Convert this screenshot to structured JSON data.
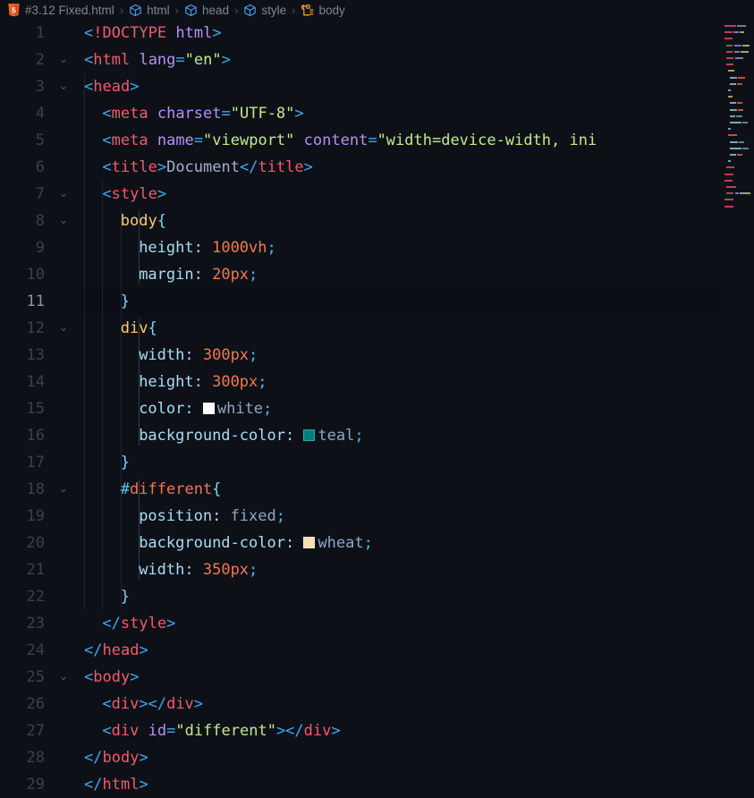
{
  "breadcrumb": {
    "items": [
      {
        "icon": "html5-file-icon",
        "label": "#3.12 Fixed.html"
      },
      {
        "icon": "symbol-class-icon",
        "label": "html"
      },
      {
        "icon": "symbol-class-icon",
        "label": "head"
      },
      {
        "icon": "symbol-class-icon",
        "label": "style"
      },
      {
        "icon": "symbol-rule-icon",
        "label": "body"
      }
    ],
    "separator": "›"
  },
  "editor": {
    "current_line": 11,
    "first_line": 1,
    "last_line": 29,
    "fold_lines": [
      2,
      3,
      7,
      8,
      12,
      18,
      25
    ],
    "colors": {
      "background": "#0d1117",
      "current_line_background": "#0b0e14",
      "tag": "#f2596b",
      "bracket": "#3aa9f5",
      "attribute": "#b490f5",
      "string": "#c3e88d",
      "selector": "#ffcb6b",
      "property": "#a9dcf5",
      "value": "#f2784b",
      "keyword_value": "#8fa6c9",
      "line_number": "#39414d",
      "line_number_active": "#8b949e"
    },
    "swatches": {
      "white": "#ffffff",
      "teal": "#008080",
      "wheat": "#f5deb3"
    },
    "lines": [
      {
        "n": 1,
        "indent": 0,
        "tokens": [
          {
            "c": "t-brk",
            "t": "<"
          },
          {
            "c": "t-doc",
            "t": "!DOCTYPE"
          },
          {
            "c": "t-txt",
            "t": " "
          },
          {
            "c": "t-attr",
            "t": "html"
          },
          {
            "c": "t-brk",
            "t": ">"
          }
        ]
      },
      {
        "n": 2,
        "indent": 0,
        "tokens": [
          {
            "c": "t-brk",
            "t": "<"
          },
          {
            "c": "t-tag",
            "t": "html"
          },
          {
            "c": "t-txt",
            "t": " "
          },
          {
            "c": "t-attr",
            "t": "lang"
          },
          {
            "c": "t-brk",
            "t": "="
          },
          {
            "c": "t-str",
            "t": "\"en\""
          },
          {
            "c": "t-brk",
            "t": ">"
          }
        ]
      },
      {
        "n": 3,
        "indent": 0,
        "tokens": [
          {
            "c": "t-brk",
            "t": "<"
          },
          {
            "c": "t-tag",
            "t": "head"
          },
          {
            "c": "t-brk",
            "t": ">"
          }
        ]
      },
      {
        "n": 4,
        "indent": 1,
        "tokens": [
          {
            "c": "t-brk",
            "t": "<"
          },
          {
            "c": "t-tag",
            "t": "meta"
          },
          {
            "c": "t-txt",
            "t": " "
          },
          {
            "c": "t-attr",
            "t": "charset"
          },
          {
            "c": "t-brk",
            "t": "="
          },
          {
            "c": "t-str",
            "t": "\"UTF-8\""
          },
          {
            "c": "t-brk",
            "t": ">"
          }
        ]
      },
      {
        "n": 5,
        "indent": 1,
        "tokens": [
          {
            "c": "t-brk",
            "t": "<"
          },
          {
            "c": "t-tag",
            "t": "meta"
          },
          {
            "c": "t-txt",
            "t": " "
          },
          {
            "c": "t-attr",
            "t": "name"
          },
          {
            "c": "t-brk",
            "t": "="
          },
          {
            "c": "t-str",
            "t": "\"viewport\""
          },
          {
            "c": "t-txt",
            "t": " "
          },
          {
            "c": "t-attr",
            "t": "content"
          },
          {
            "c": "t-brk",
            "t": "="
          },
          {
            "c": "t-str",
            "t": "\"width=device-width, ini"
          }
        ]
      },
      {
        "n": 6,
        "indent": 1,
        "tokens": [
          {
            "c": "t-brk",
            "t": "<"
          },
          {
            "c": "t-tag",
            "t": "title"
          },
          {
            "c": "t-brk",
            "t": ">"
          },
          {
            "c": "t-txt",
            "t": "Document"
          },
          {
            "c": "t-brk",
            "t": "</"
          },
          {
            "c": "t-tag",
            "t": "title"
          },
          {
            "c": "t-brk",
            "t": ">"
          }
        ]
      },
      {
        "n": 7,
        "indent": 1,
        "tokens": [
          {
            "c": "t-brk",
            "t": "<"
          },
          {
            "c": "t-tag",
            "t": "style"
          },
          {
            "c": "t-brk",
            "t": ">"
          }
        ]
      },
      {
        "n": 8,
        "indent": 2,
        "tokens": [
          {
            "c": "t-sel",
            "t": "body"
          },
          {
            "c": "t-brace",
            "t": "{"
          }
        ]
      },
      {
        "n": 9,
        "indent": 3,
        "tokens": [
          {
            "c": "t-prop",
            "t": "height"
          },
          {
            "c": "t-prop",
            "t": ": "
          },
          {
            "c": "t-val",
            "t": "1000vh"
          },
          {
            "c": "t-semi",
            "t": ";"
          }
        ]
      },
      {
        "n": 10,
        "indent": 3,
        "tokens": [
          {
            "c": "t-prop",
            "t": "margin"
          },
          {
            "c": "t-prop",
            "t": ": "
          },
          {
            "c": "t-val",
            "t": "20px"
          },
          {
            "c": "t-semi",
            "t": ";"
          }
        ]
      },
      {
        "n": 11,
        "indent": 2,
        "tokens": [
          {
            "c": "t-brace",
            "t": "}"
          }
        ]
      },
      {
        "n": 12,
        "indent": 2,
        "tokens": [
          {
            "c": "t-sel",
            "t": "div"
          },
          {
            "c": "t-brace",
            "t": "{"
          }
        ]
      },
      {
        "n": 13,
        "indent": 3,
        "tokens": [
          {
            "c": "t-prop",
            "t": "width"
          },
          {
            "c": "t-prop",
            "t": ": "
          },
          {
            "c": "t-val",
            "t": "300px"
          },
          {
            "c": "t-semi",
            "t": ";"
          }
        ]
      },
      {
        "n": 14,
        "indent": 3,
        "tokens": [
          {
            "c": "t-prop",
            "t": "height"
          },
          {
            "c": "t-prop",
            "t": ": "
          },
          {
            "c": "t-val",
            "t": "300px"
          },
          {
            "c": "t-semi",
            "t": ";"
          }
        ]
      },
      {
        "n": 15,
        "indent": 3,
        "swatch": "white",
        "tokens": [
          {
            "c": "t-prop",
            "t": "color"
          },
          {
            "c": "t-prop",
            "t": ": "
          },
          {
            "c": "swatch",
            "t": ""
          },
          {
            "c": "t-kw",
            "t": "white"
          },
          {
            "c": "t-semi",
            "t": ";"
          }
        ]
      },
      {
        "n": 16,
        "indent": 3,
        "swatch": "teal",
        "tokens": [
          {
            "c": "t-prop",
            "t": "background-color"
          },
          {
            "c": "t-prop",
            "t": ": "
          },
          {
            "c": "swatch",
            "t": ""
          },
          {
            "c": "t-kw",
            "t": "teal"
          },
          {
            "c": "t-semi",
            "t": ";"
          }
        ]
      },
      {
        "n": 17,
        "indent": 2,
        "tokens": [
          {
            "c": "t-brace",
            "t": "}"
          }
        ]
      },
      {
        "n": 18,
        "indent": 2,
        "tokens": [
          {
            "c": "t-hash",
            "t": "#"
          },
          {
            "c": "t-idname",
            "t": "different"
          },
          {
            "c": "t-brace",
            "t": "{"
          }
        ]
      },
      {
        "n": 19,
        "indent": 3,
        "tokens": [
          {
            "c": "t-prop",
            "t": "position"
          },
          {
            "c": "t-prop",
            "t": ": "
          },
          {
            "c": "t-kw",
            "t": "fixed"
          },
          {
            "c": "t-semi",
            "t": ";"
          }
        ]
      },
      {
        "n": 20,
        "indent": 3,
        "swatch": "wheat",
        "tokens": [
          {
            "c": "t-prop",
            "t": "background-color"
          },
          {
            "c": "t-prop",
            "t": ": "
          },
          {
            "c": "swatch",
            "t": ""
          },
          {
            "c": "t-kw",
            "t": "wheat"
          },
          {
            "c": "t-semi",
            "t": ";"
          }
        ]
      },
      {
        "n": 21,
        "indent": 3,
        "tokens": [
          {
            "c": "t-prop",
            "t": "width"
          },
          {
            "c": "t-prop",
            "t": ": "
          },
          {
            "c": "t-val",
            "t": "350px"
          },
          {
            "c": "t-semi",
            "t": ";"
          }
        ]
      },
      {
        "n": 22,
        "indent": 2,
        "tokens": [
          {
            "c": "t-brace",
            "t": "}"
          }
        ]
      },
      {
        "n": 23,
        "indent": 1,
        "tokens": [
          {
            "c": "t-brk",
            "t": "</"
          },
          {
            "c": "t-tag",
            "t": "style"
          },
          {
            "c": "t-brk",
            "t": ">"
          }
        ]
      },
      {
        "n": 24,
        "indent": 0,
        "tokens": [
          {
            "c": "t-brk",
            "t": "</"
          },
          {
            "c": "t-tag",
            "t": "head"
          },
          {
            "c": "t-brk",
            "t": ">"
          }
        ]
      },
      {
        "n": 25,
        "indent": 0,
        "tokens": [
          {
            "c": "t-brk",
            "t": "<"
          },
          {
            "c": "t-tag",
            "t": "body"
          },
          {
            "c": "t-brk",
            "t": ">"
          }
        ]
      },
      {
        "n": 26,
        "indent": 1,
        "tokens": [
          {
            "c": "t-brk",
            "t": "<"
          },
          {
            "c": "t-tag",
            "t": "div"
          },
          {
            "c": "t-brk",
            "t": "></"
          },
          {
            "c": "t-tag",
            "t": "div"
          },
          {
            "c": "t-brk",
            "t": ">"
          }
        ]
      },
      {
        "n": 27,
        "indent": 1,
        "tokens": [
          {
            "c": "t-brk",
            "t": "<"
          },
          {
            "c": "t-tag",
            "t": "div"
          },
          {
            "c": "t-txt",
            "t": " "
          },
          {
            "c": "t-attr",
            "t": "id"
          },
          {
            "c": "t-brk",
            "t": "="
          },
          {
            "c": "t-str",
            "t": "\"different\""
          },
          {
            "c": "t-brk",
            "t": "></"
          },
          {
            "c": "t-tag",
            "t": "div"
          },
          {
            "c": "t-brk",
            "t": ">"
          }
        ]
      },
      {
        "n": 28,
        "indent": 0,
        "tokens": [
          {
            "c": "t-brk",
            "t": "</"
          },
          {
            "c": "t-tag",
            "t": "body"
          },
          {
            "c": "t-brk",
            "t": ">"
          }
        ]
      },
      {
        "n": 29,
        "indent": 0,
        "tokens": [
          {
            "c": "t-brk",
            "t": "</"
          },
          {
            "c": "t-tag",
            "t": "html"
          },
          {
            "c": "t-brk",
            "t": ">"
          }
        ]
      }
    ]
  },
  "minimap": {
    "visible": true,
    "lines": [
      {
        "n": 1,
        "indent": 0,
        "segs": [
          {
            "w": 14,
            "c": "#f2596b"
          },
          {
            "w": 10,
            "c": "#b490f5"
          }
        ]
      },
      {
        "n": 2,
        "indent": 0,
        "segs": [
          {
            "w": 9,
            "c": "#f2596b"
          },
          {
            "w": 7,
            "c": "#b490f5"
          },
          {
            "w": 5,
            "c": "#c3e88d"
          }
        ]
      },
      {
        "n": 3,
        "indent": 0,
        "segs": [
          {
            "w": 9,
            "c": "#f2596b"
          }
        ]
      },
      {
        "n": 4,
        "indent": 2,
        "segs": [
          {
            "w": 8,
            "c": "#f2596b"
          },
          {
            "w": 9,
            "c": "#b490f5"
          },
          {
            "w": 8,
            "c": "#c3e88d"
          }
        ]
      },
      {
        "n": 5,
        "indent": 2,
        "segs": [
          {
            "w": 8,
            "c": "#f2596b"
          },
          {
            "w": 7,
            "c": "#b490f5"
          },
          {
            "w": 9,
            "c": "#c3e88d"
          }
        ]
      },
      {
        "n": 6,
        "indent": 2,
        "segs": [
          {
            "w": 9,
            "c": "#f2596b"
          },
          {
            "w": 10,
            "c": "#a4b1cd"
          }
        ]
      },
      {
        "n": 7,
        "indent": 2,
        "segs": [
          {
            "w": 9,
            "c": "#f2596b"
          }
        ]
      },
      {
        "n": 8,
        "indent": 4,
        "segs": [
          {
            "w": 8,
            "c": "#ffcb6b"
          }
        ]
      },
      {
        "n": 9,
        "indent": 6,
        "segs": [
          {
            "w": 9,
            "c": "#a9dcf5"
          },
          {
            "w": 8,
            "c": "#f2784b"
          }
        ]
      },
      {
        "n": 10,
        "indent": 6,
        "segs": [
          {
            "w": 8,
            "c": "#a9dcf5"
          },
          {
            "w": 6,
            "c": "#f2784b"
          }
        ]
      },
      {
        "n": 11,
        "indent": 4,
        "segs": [
          {
            "w": 3,
            "c": "#7fd3f7"
          }
        ]
      },
      {
        "n": 12,
        "indent": 4,
        "segs": [
          {
            "w": 6,
            "c": "#ffcb6b"
          }
        ]
      },
      {
        "n": 13,
        "indent": 6,
        "segs": [
          {
            "w": 8,
            "c": "#a9dcf5"
          },
          {
            "w": 6,
            "c": "#f2784b"
          }
        ]
      },
      {
        "n": 14,
        "indent": 6,
        "segs": [
          {
            "w": 9,
            "c": "#a9dcf5"
          },
          {
            "w": 6,
            "c": "#f2784b"
          }
        ]
      },
      {
        "n": 15,
        "indent": 6,
        "segs": [
          {
            "w": 7,
            "c": "#a9dcf5"
          },
          {
            "w": 7,
            "c": "#8fa6c9"
          }
        ]
      },
      {
        "n": 16,
        "indent": 6,
        "segs": [
          {
            "w": 14,
            "c": "#a9dcf5"
          },
          {
            "w": 6,
            "c": "#8fa6c9"
          }
        ]
      },
      {
        "n": 17,
        "indent": 4,
        "segs": [
          {
            "w": 3,
            "c": "#7fd3f7"
          }
        ]
      },
      {
        "n": 18,
        "indent": 4,
        "segs": [
          {
            "w": 11,
            "c": "#f2735a"
          }
        ]
      },
      {
        "n": 19,
        "indent": 6,
        "segs": [
          {
            "w": 10,
            "c": "#a9dcf5"
          },
          {
            "w": 6,
            "c": "#8fa6c9"
          }
        ]
      },
      {
        "n": 20,
        "indent": 6,
        "segs": [
          {
            "w": 14,
            "c": "#a9dcf5"
          },
          {
            "w": 7,
            "c": "#8fa6c9"
          }
        ]
      },
      {
        "n": 21,
        "indent": 6,
        "segs": [
          {
            "w": 8,
            "c": "#a9dcf5"
          },
          {
            "w": 6,
            "c": "#f2784b"
          }
        ]
      },
      {
        "n": 22,
        "indent": 4,
        "segs": [
          {
            "w": 3,
            "c": "#7fd3f7"
          }
        ]
      },
      {
        "n": 23,
        "indent": 2,
        "segs": [
          {
            "w": 10,
            "c": "#f2596b"
          }
        ]
      },
      {
        "n": 24,
        "indent": 0,
        "segs": [
          {
            "w": 10,
            "c": "#f2596b"
          }
        ]
      },
      {
        "n": 25,
        "indent": 0,
        "segs": [
          {
            "w": 9,
            "c": "#f2596b"
          }
        ]
      },
      {
        "n": 26,
        "indent": 2,
        "segs": [
          {
            "w": 12,
            "c": "#f2596b"
          }
        ]
      },
      {
        "n": 27,
        "indent": 2,
        "segs": [
          {
            "w": 9,
            "c": "#f2596b"
          },
          {
            "w": 5,
            "c": "#b490f5"
          },
          {
            "w": 12,
            "c": "#c3e88d"
          }
        ]
      },
      {
        "n": 28,
        "indent": 0,
        "segs": [
          {
            "w": 10,
            "c": "#f2596b"
          }
        ]
      },
      {
        "n": 29,
        "indent": 0,
        "segs": [
          {
            "w": 10,
            "c": "#f2596b"
          }
        ]
      }
    ]
  }
}
